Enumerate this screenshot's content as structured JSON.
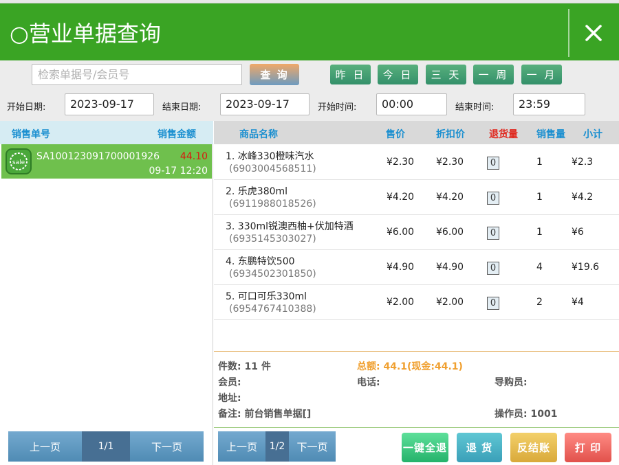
{
  "window": {
    "title": "○营业单据查询"
  },
  "search": {
    "placeholder": "检索单据号/会员号",
    "query_label": "查 询"
  },
  "quick_ranges": [
    "昨 日",
    "今 日",
    "三 天",
    "一 周",
    "一 月"
  ],
  "filters": {
    "start_date_label": "开始日期:",
    "start_date": "2023-09-17",
    "end_date_label": "结束日期:",
    "end_date": "2023-09-17",
    "start_time_label": "开始时间:",
    "start_time": "00:00",
    "end_time_label": "结束时间:",
    "end_time": "23:59"
  },
  "orders": {
    "headers": [
      "销售单号",
      "销售金额"
    ],
    "items": [
      {
        "no": "SA100123091700001926",
        "amount": "44.10",
        "time": "09-17 12:20",
        "icon_text": "sale"
      }
    ],
    "pager": {
      "prev": "上一页",
      "page": "1/1",
      "next": "下一页"
    }
  },
  "items": {
    "headers": [
      "商品名称",
      "售价",
      "折扣价",
      "退货量",
      "销售量",
      "小计"
    ],
    "rows": [
      {
        "name": "1. 冰峰330橙味汽水",
        "code": "(6903004568511)",
        "price": "¥2.30",
        "discount": "¥2.30",
        "return_qty": "0",
        "qty": "1",
        "subtotal": "¥2.3"
      },
      {
        "name": "2. 乐虎380ml",
        "code": "(6911988018526)",
        "price": "¥4.20",
        "discount": "¥4.20",
        "return_qty": "0",
        "qty": "1",
        "subtotal": "¥4.2"
      },
      {
        "name": "3. 330ml锐澳西柚+伏加特酒",
        "code": "(6935145303027)",
        "price": "¥6.00",
        "discount": "¥6.00",
        "return_qty": "0",
        "qty": "1",
        "subtotal": "¥6"
      },
      {
        "name": "4. 东鹏特饮500",
        "code": "(6934502301850)",
        "price": "¥4.90",
        "discount": "¥4.90",
        "return_qty": "0",
        "qty": "4",
        "subtotal": "¥19.6"
      },
      {
        "name": "5. 可口可乐330ml",
        "code": "(6954767410388)",
        "price": "¥2.00",
        "discount": "¥2.00",
        "return_qty": "0",
        "qty": "2",
        "subtotal": "¥4"
      }
    ],
    "pager": {
      "prev": "上一页",
      "page": "1/2",
      "next": "下一页"
    }
  },
  "summary": {
    "count": "件数: 11 件",
    "total": "总额: 44.1(现金:44.1)",
    "member": "会员:",
    "phone": "电话:",
    "guide": "导购员:",
    "address": "地址:",
    "remark": "备注: 前台销售单据[]",
    "operator": "操作员: 1001"
  },
  "actions": {
    "refund_all": "一键全退",
    "refund": "退 货",
    "unsettle": "反结账",
    "print": "打 印"
  },
  "colors": {
    "title_bg": "#3aa424",
    "selected_row": "#6fc04d",
    "accent_blue": "#1a8fd0",
    "alert_red": "#e0251b"
  }
}
